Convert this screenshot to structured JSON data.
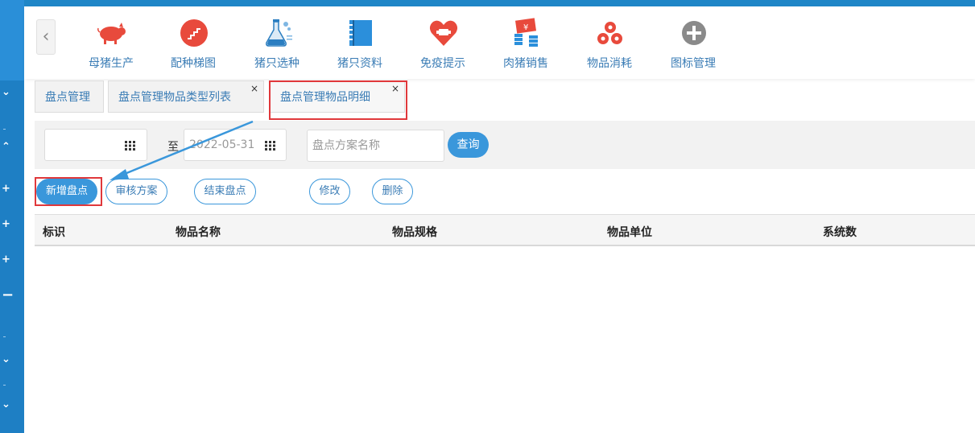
{
  "nav": {
    "items": [
      {
        "label": "母猪生产",
        "icon": "pig-icon"
      },
      {
        "label": "配种梯图",
        "icon": "stairs-icon"
      },
      {
        "label": "猪只选种",
        "icon": "flask-icon"
      },
      {
        "label": "猪只资料",
        "icon": "book-icon"
      },
      {
        "label": "免疫提示",
        "icon": "heart-icon"
      },
      {
        "label": "肉猪销售",
        "icon": "money-icon"
      },
      {
        "label": "物品消耗",
        "icon": "circles-icon"
      },
      {
        "label": "图标管理",
        "icon": "plus-circle-icon"
      }
    ]
  },
  "tabs": [
    {
      "label": "盘点管理"
    },
    {
      "label": "盘点管理物品类型列表"
    },
    {
      "label": "盘点管理物品明细"
    }
  ],
  "filter": {
    "to_label": "至",
    "end_date": "2022-05-31",
    "plan_placeholder": "盘点方案名称",
    "query_label": "查询"
  },
  "actions": {
    "add": "新增盘点",
    "review": "审核方案",
    "finish": "结束盘点",
    "edit": "修改",
    "delete": "删除"
  },
  "table": {
    "columns": [
      "标识",
      "物品名称",
      "物品规格",
      "物品单位",
      "系统数"
    ]
  },
  "colors": {
    "accent": "#3a97db",
    "highlight": "#e0383b",
    "sidebar": "#1e7fc4"
  }
}
